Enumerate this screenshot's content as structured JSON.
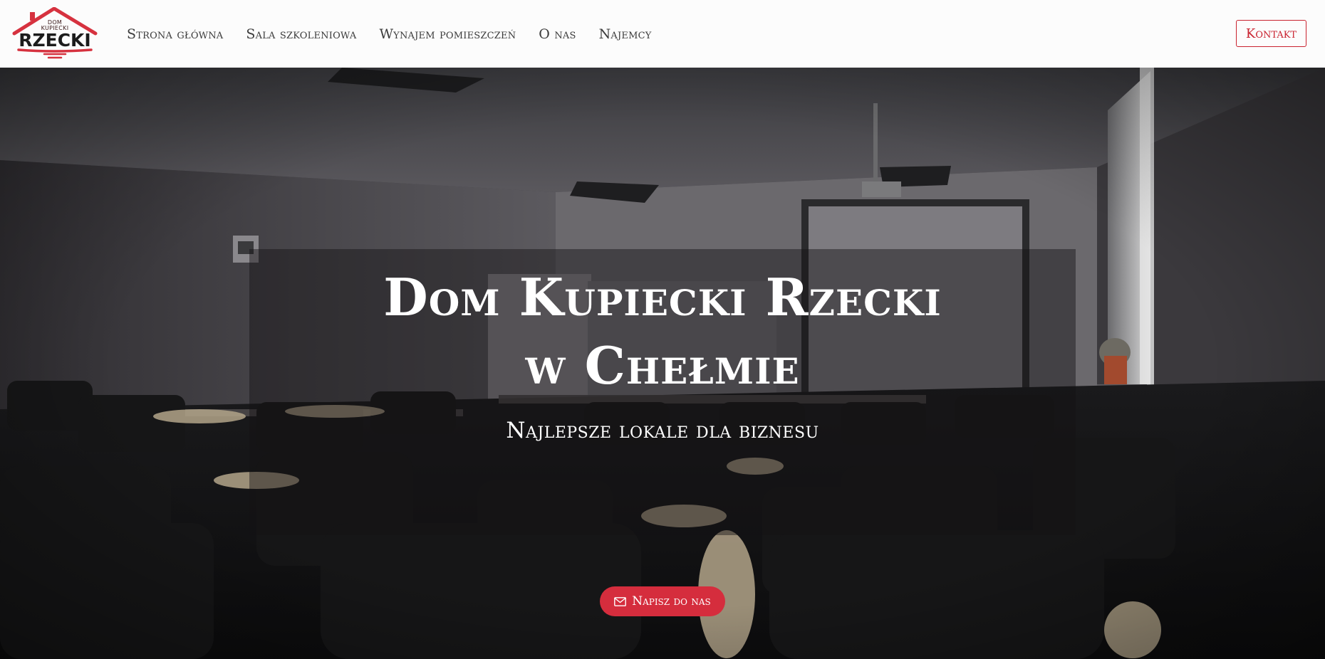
{
  "brand": {
    "logo_line1": "DOM",
    "logo_line2": "KUPIECKI",
    "logo_main": "RZECKI",
    "accent_color": "#c9222f"
  },
  "nav": {
    "items": [
      {
        "label": "Strona główna"
      },
      {
        "label": "Sala szkoleniowa"
      },
      {
        "label": "Wynajem pomieszczeń"
      },
      {
        "label": "O nas"
      },
      {
        "label": "Najemcy"
      }
    ],
    "contact_label": "Kontakt"
  },
  "hero": {
    "title_line1": "Dom Kupiecki Rzecki",
    "title_line2": "w Chełmie",
    "subtitle": "Najlepsze lokale dla biznesu",
    "cta_label": "Napisz do nas",
    "cta_icon": "envelope-icon",
    "cta_color": "#d52d3d",
    "background": "photo of a dim conference room with black chairs, projector and screen"
  }
}
